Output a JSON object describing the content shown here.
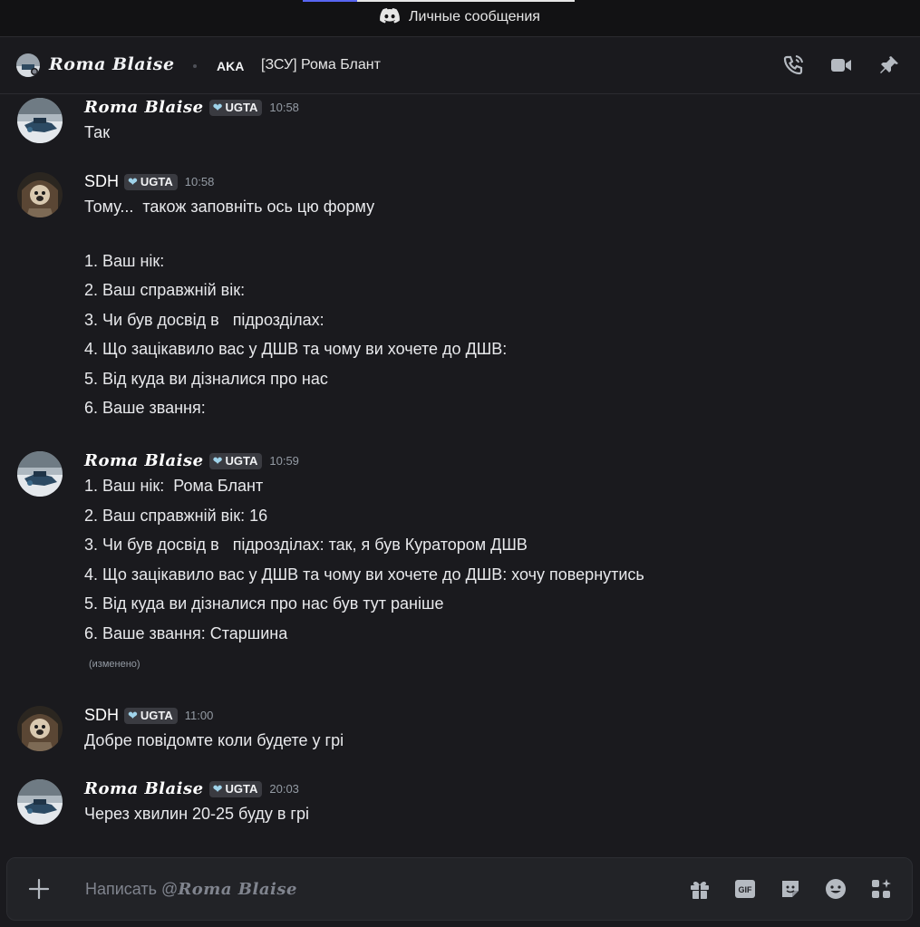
{
  "window": {
    "title": "Личные сообщения"
  },
  "header": {
    "display_name": "𝑹𝒐𝒎𝒂 𝑩𝒍𝒂𝒊𝒔𝒆",
    "aka_label": "AKA",
    "nickname": "[ЗСУ] Рома Блант"
  },
  "messages": [
    {
      "author": "𝑹𝒐𝒎𝒂 𝑩𝒍𝒂𝒊𝒔𝒆",
      "tag": "UGTA",
      "time": "10:58",
      "lines": [
        "Так"
      ]
    },
    {
      "author": "SDH",
      "tag": "UGTA",
      "time": "10:58",
      "lines": [
        "Тому...  також заповніть ось цю форму",
        "1. Ваш нік:",
        "2. Ваш справжній вік:",
        "3. Чи був досвід в   підрозділах:",
        "4. Що зацікавило вас у ДШВ та чому ви хочете до ДШВ:",
        "5. Від куда ви дізналися про нас",
        "6. Ваше звання:"
      ]
    },
    {
      "author": "𝑹𝒐𝒎𝒂 𝑩𝒍𝒂𝒊𝒔𝒆",
      "tag": "UGTA",
      "time": "10:59",
      "edited": "(изменено)",
      "lines": [
        "1. Ваш нік:  Рома Блант",
        "2. Ваш справжній вік: 16",
        "3. Чи був досвід в   підрозділах: так, я був Куратором ДШВ",
        "4. Що зацікавило вас у ДШВ та чому ви хочете до ДШВ: хочу повернутись",
        "5. Від куда ви дізналися про нас був тут раніше",
        "6. Ваше звання: Старшина"
      ]
    },
    {
      "author": "SDH",
      "tag": "UGTA",
      "time": "11:00",
      "lines": [
        "Добре повідомте коли будете у грі"
      ]
    },
    {
      "author": "𝑹𝒐𝒎𝒂 𝑩𝒍𝒂𝒊𝒔𝒆",
      "tag": "UGTA",
      "time": "20:03",
      "lines": [
        "Через хвилин 20-25 буду в грі"
      ]
    }
  ],
  "composer": {
    "placeholder_prefix": "Написать @",
    "placeholder_name": "𝑹𝒐𝒎𝒂 𝑩𝒍𝒂𝒊𝒔𝒆",
    "gif_label": "GIF"
  }
}
